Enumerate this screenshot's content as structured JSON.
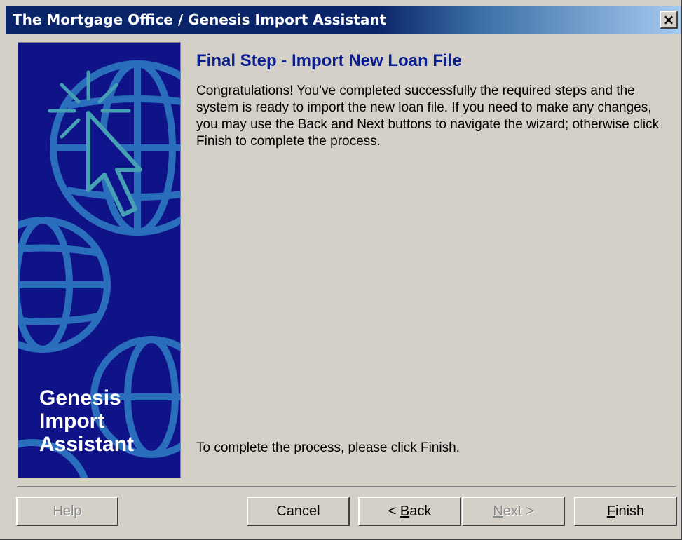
{
  "window": {
    "title": "The Mortgage Office / Genesis Import Assistant",
    "close_glyph": "×"
  },
  "banner": {
    "lines": [
      "Genesis",
      "Import",
      "Assistant"
    ],
    "icons": [
      "globe-icon",
      "cursor-click-icon"
    ],
    "background_color": "#10148c",
    "graphic_color": "#2f7fc6"
  },
  "content": {
    "heading": "Final Step - Import New Loan File",
    "body": "Congratulations!  You've completed successfully the required steps and the system is ready to import the new loan file. If you need to make any changes, you may use the Back and Next buttons to navigate the wizard; otherwise click Finish to complete the process.",
    "footer": "To complete the process, please click Finish."
  },
  "buttons": {
    "help": {
      "label": "Help",
      "enabled": false
    },
    "cancel": {
      "label": "Cancel",
      "enabled": true
    },
    "back": {
      "prefix": "< ",
      "mnemonic": "B",
      "rest": "ack",
      "enabled": true
    },
    "next": {
      "mnemonic": "N",
      "rest": "ext >",
      "enabled": false
    },
    "finish": {
      "mnemonic": "F",
      "rest": "inish",
      "enabled": true
    }
  }
}
